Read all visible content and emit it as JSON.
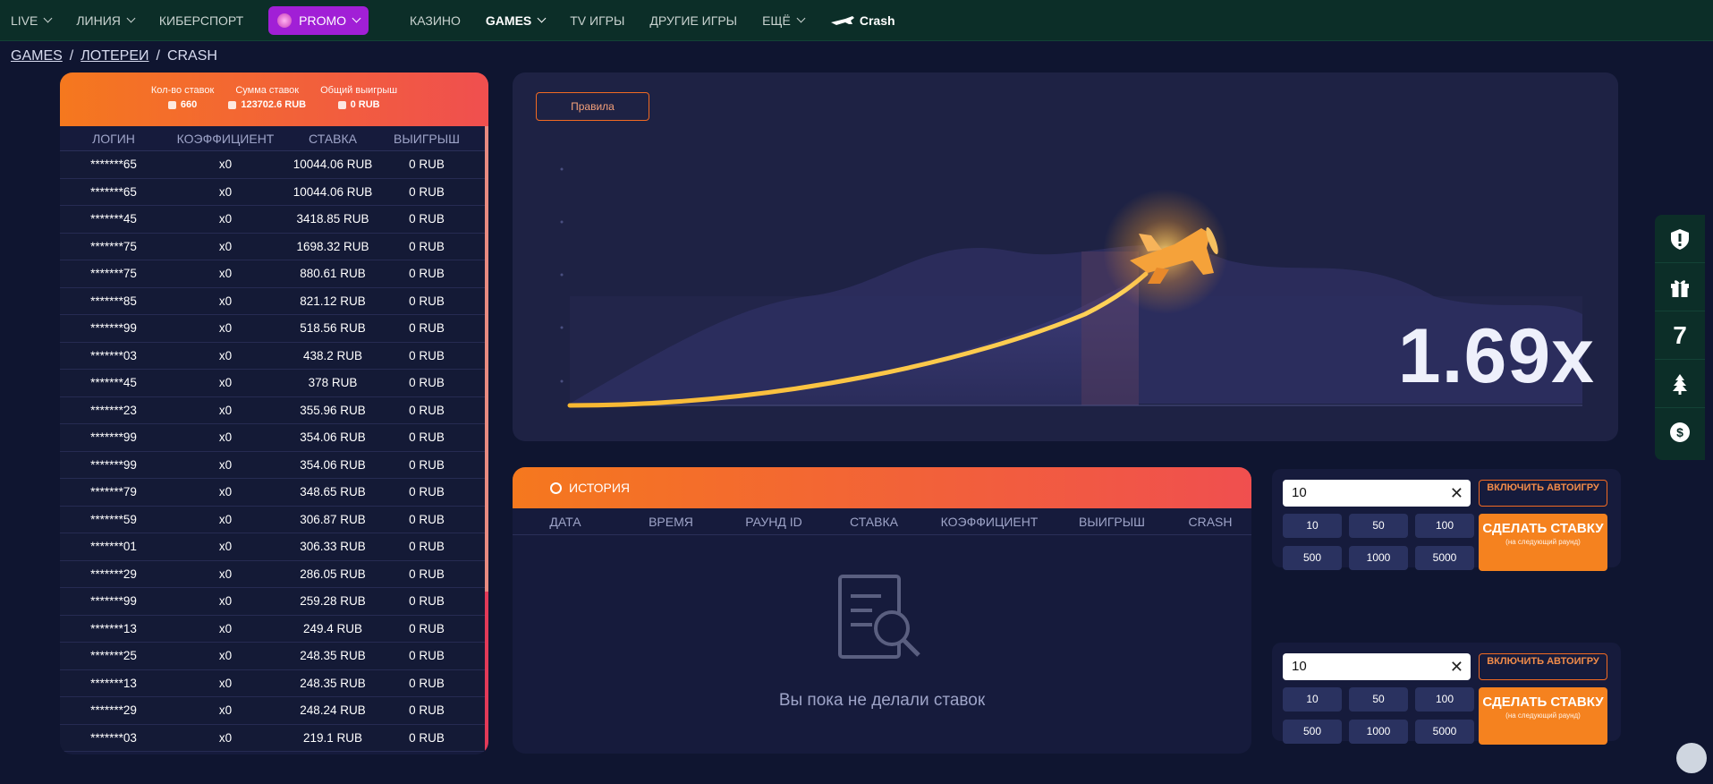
{
  "nav": {
    "items": [
      {
        "label": "LIVE",
        "chev": true
      },
      {
        "label": "ЛИНИЯ",
        "chev": true
      },
      {
        "label": "КИБЕРСПОРТ",
        "chev": false
      }
    ],
    "promo_label": "PROMO",
    "items2": [
      {
        "label": "КАЗИНО",
        "chev": false
      },
      {
        "label": "GAMES",
        "chev": true,
        "active": true
      },
      {
        "label": "TV ИГРЫ",
        "chev": false
      },
      {
        "label": "ДРУГИЕ ИГРЫ",
        "chev": false
      },
      {
        "label": "ЕЩЁ",
        "chev": true
      }
    ],
    "crash_label": "Crash"
  },
  "breadcrumb": {
    "games": "GAMES",
    "lotteries": "ЛОТЕРЕИ",
    "crash": "CRASH",
    "sep": "/"
  },
  "stats": {
    "count_label": "Кол-во ставок",
    "count_value": "660",
    "sum_label": "Сумма ставок",
    "sum_value": "123702.6 RUB",
    "win_label": "Общий выигрыш",
    "win_value": "0 RUB"
  },
  "bets_table": {
    "columns": [
      "ЛОГИН",
      "КОЭФФИЦИЕНТ",
      "СТАВКА",
      "ВЫИГРЫШ"
    ],
    "rows": [
      [
        "*******65",
        "x0",
        "10044.06 RUB",
        "0 RUB"
      ],
      [
        "*******65",
        "x0",
        "10044.06 RUB",
        "0 RUB"
      ],
      [
        "*******45",
        "x0",
        "3418.85 RUB",
        "0 RUB"
      ],
      [
        "*******75",
        "x0",
        "1698.32 RUB",
        "0 RUB"
      ],
      [
        "*******75",
        "x0",
        "880.61 RUB",
        "0 RUB"
      ],
      [
        "*******85",
        "x0",
        "821.12 RUB",
        "0 RUB"
      ],
      [
        "*******99",
        "x0",
        "518.56 RUB",
        "0 RUB"
      ],
      [
        "*******03",
        "x0",
        "438.2 RUB",
        "0 RUB"
      ],
      [
        "*******45",
        "x0",
        "378 RUB",
        "0 RUB"
      ],
      [
        "*******23",
        "x0",
        "355.96 RUB",
        "0 RUB"
      ],
      [
        "*******99",
        "x0",
        "354.06 RUB",
        "0 RUB"
      ],
      [
        "*******99",
        "x0",
        "354.06 RUB",
        "0 RUB"
      ],
      [
        "*******79",
        "x0",
        "348.65 RUB",
        "0 RUB"
      ],
      [
        "*******59",
        "x0",
        "306.87 RUB",
        "0 RUB"
      ],
      [
        "*******01",
        "x0",
        "306.33 RUB",
        "0 RUB"
      ],
      [
        "*******29",
        "x0",
        "286.05 RUB",
        "0 RUB"
      ],
      [
        "*******99",
        "x0",
        "259.28 RUB",
        "0 RUB"
      ],
      [
        "*******13",
        "x0",
        "249.4 RUB",
        "0 RUB"
      ],
      [
        "*******25",
        "x0",
        "248.35 RUB",
        "0 RUB"
      ],
      [
        "*******13",
        "x0",
        "248.35 RUB",
        "0 RUB"
      ],
      [
        "*******29",
        "x0",
        "248.24 RUB",
        "0 RUB"
      ],
      [
        "*******03",
        "x0",
        "219.1 RUB",
        "0 RUB"
      ]
    ]
  },
  "game": {
    "rules_label": "Правила",
    "multiplier": "1.69x"
  },
  "history": {
    "title": "ИСТОРИЯ",
    "columns": [
      "ДАТА",
      "ВРЕМЯ",
      "РАУНД ID",
      "СТАВКА",
      "КОЭФФИЦИЕНТ",
      "ВЫИГРЫШ",
      "CRASH"
    ],
    "empty_text": "Вы пока не делали ставок"
  },
  "bet_panels": [
    {
      "value": "10",
      "auto_label": "ВКЛЮЧИТЬ АВТОИГРУ",
      "chips": [
        "10",
        "50",
        "100",
        "500",
        "1000",
        "5000"
      ],
      "make_label": "СДЕЛАТЬ СТАВКУ",
      "make_sub": "(на следующий раунд)"
    },
    {
      "value": "10",
      "auto_label": "ВКЛЮЧИТЬ АВТОИГРУ",
      "chips": [
        "10",
        "50",
        "100",
        "500",
        "1000",
        "5000"
      ],
      "make_label": "СДЕЛАТЬ СТАВКУ",
      "make_sub": "(на следующий раунд)"
    }
  ],
  "sidebar": {
    "icons": [
      "info-shield-icon",
      "gift-icon",
      "seven-icon",
      "tree-icon",
      "dollar-icon"
    ],
    "seven_label": "7"
  },
  "colors": {
    "accent": "#f5821f",
    "nav_bg": "#0c2e28",
    "page_bg": "#0f1530",
    "panel_bg": "#161b3c",
    "promo": "#a11fd6"
  }
}
